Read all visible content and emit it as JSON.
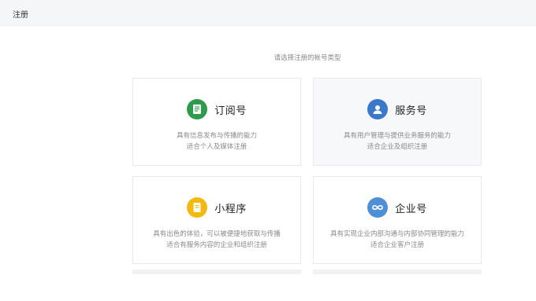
{
  "header": {
    "title": "注册"
  },
  "subtitle": "请选择注册的帐号类型",
  "cards": [
    {
      "name": "订阅号",
      "icon": "document-icon",
      "color": "#2e9b4c",
      "desc1": "具有信息发布与传播的能力",
      "desc2": "适合个人及媒体注册"
    },
    {
      "name": "服务号",
      "icon": "user-icon",
      "color": "#3a78c9",
      "desc1": "具有用户管理与提供业务服务的能力",
      "desc2": "适合企业及组织注册"
    },
    {
      "name": "小程序",
      "icon": "page-icon",
      "color": "#f2b90f",
      "desc1": "具有出色的体验，可以被便捷地获取与传播",
      "desc2": "适合有服务内容的企业和组织注册"
    },
    {
      "name": "企业号",
      "icon": "link-icon",
      "color": "#4f8fd8",
      "desc1": "具有实现企业内部沟通与内部协同管理的能力",
      "desc2": "适合企业客户注册"
    }
  ]
}
